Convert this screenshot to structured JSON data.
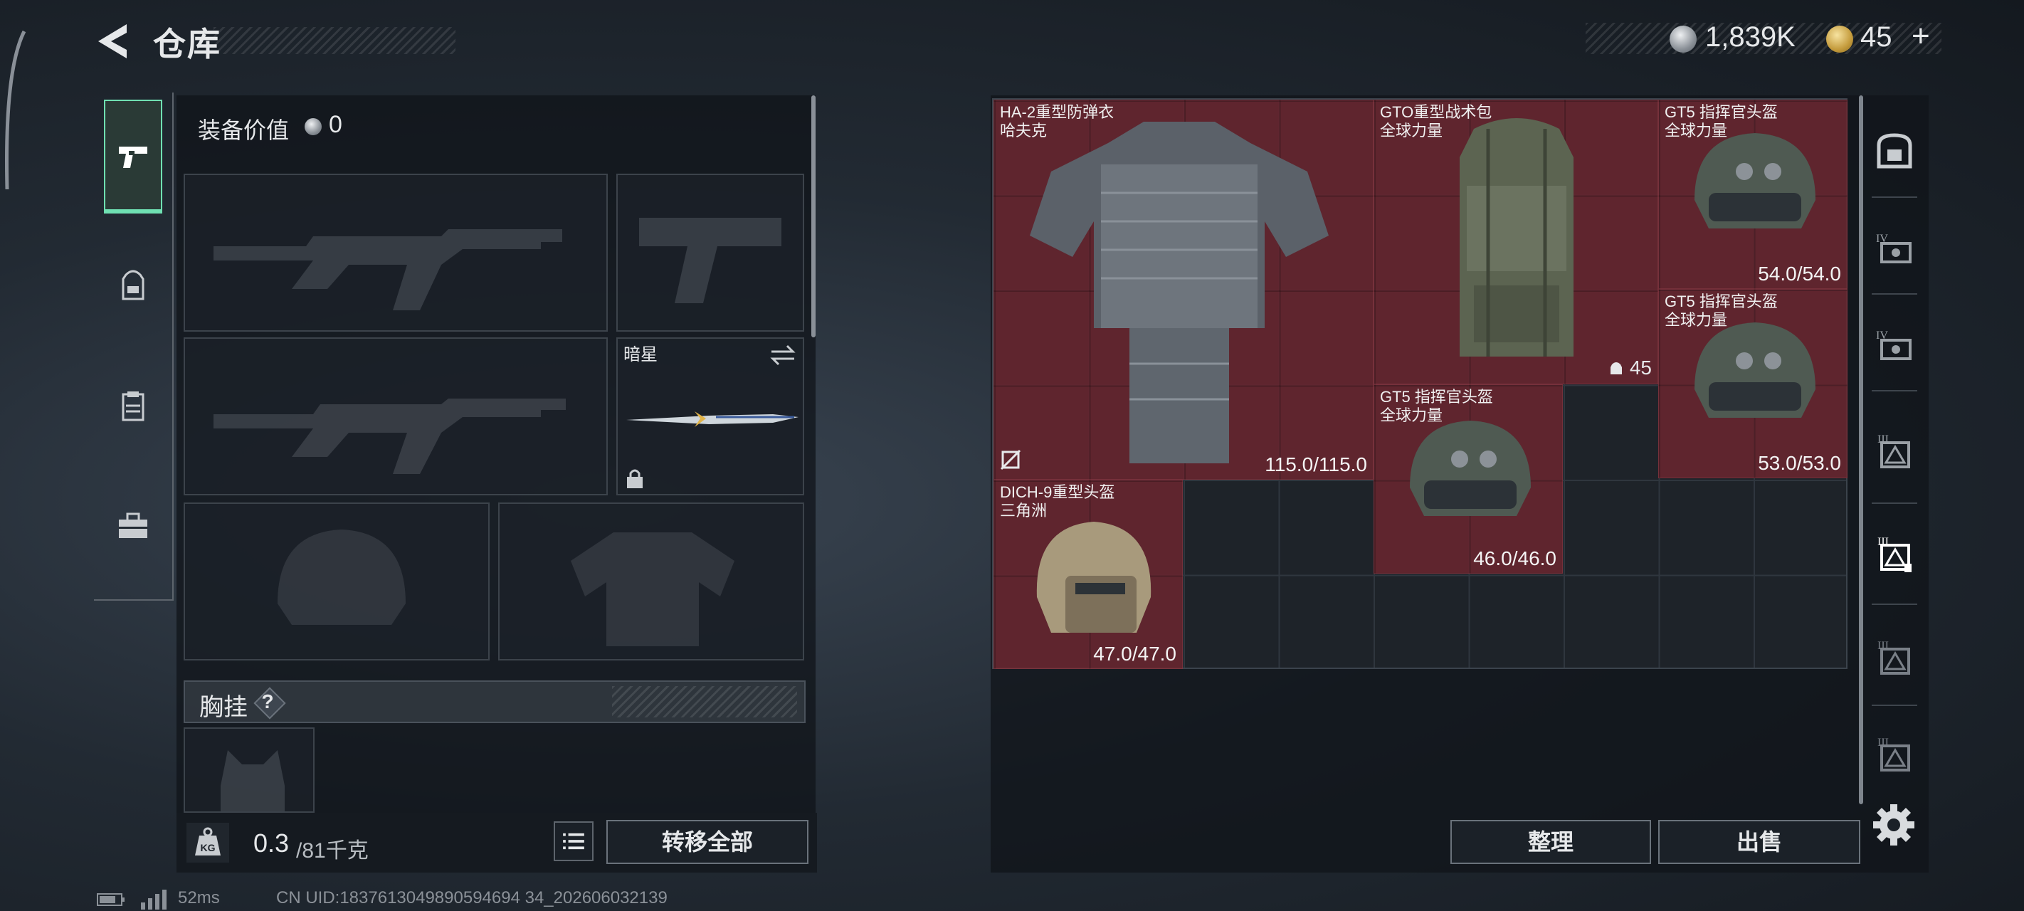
{
  "header": {
    "title": "仓库",
    "back_icon": "chevron-left-icon",
    "silver_amount": "1,839K",
    "gold_amount": "45",
    "gold_plus": "+"
  },
  "left_tabs": [
    {
      "name": "weapons",
      "icon": "pistol-icon",
      "active": true
    },
    {
      "name": "gear",
      "icon": "backpack-icon",
      "active": false
    },
    {
      "name": "consumables",
      "icon": "clipboard-icon",
      "active": false
    },
    {
      "name": "tools",
      "icon": "toolbox-icon",
      "active": false
    }
  ],
  "equipment": {
    "value_label": "装备价值",
    "value_amount": "0",
    "melee_name": "暗星",
    "chest_label": "胸挂",
    "chest_help": "?",
    "weight_current": "0.3",
    "weight_max": "/81千克",
    "transfer_all": "转移全部"
  },
  "storage": {
    "items": [
      {
        "id": "armor",
        "name": "HA-2重型防弹衣",
        "sub": "哈夫克",
        "durability": "115.0/115.0"
      },
      {
        "id": "backpack",
        "name": "GTO重型战术包",
        "sub": "全球力量",
        "capacity": "45"
      },
      {
        "id": "helmet-gt5-1",
        "name": "GT5 指挥官头盔",
        "sub": "全球力量",
        "durability": "54.0/54.0"
      },
      {
        "id": "helmet-gt5-2",
        "name": "GT5 指挥官头盔",
        "sub": "全球力量",
        "durability": "53.0/53.0"
      },
      {
        "id": "helmet-gt5-3",
        "name": "GT5 指挥官头盔",
        "sub": "全球力量",
        "durability": "46.0/46.0"
      },
      {
        "id": "helmet-dich",
        "name": "DICH-9重型头盔",
        "sub": "三角洲",
        "durability": "47.0/47.0"
      }
    ],
    "organize": "整理",
    "sell": "出售"
  },
  "right_tabs": [
    {
      "icon": "safe-box-icon"
    },
    {
      "icon": "storage-tier-iv-icon",
      "tier": "IV"
    },
    {
      "icon": "storage-tier-iv-icon",
      "tier": "IV"
    },
    {
      "icon": "storage-tier-iii-icon",
      "tier": "III"
    },
    {
      "icon": "storage-tier-iii-icon",
      "tier": "III",
      "active": true
    },
    {
      "icon": "storage-tier-iii-icon",
      "tier": "III"
    },
    {
      "icon": "storage-tier-iii-icon",
      "tier": "III"
    }
  ],
  "footer": {
    "ping": "52ms",
    "uid": "CN UID:1837613049890594694 34_202606032139"
  },
  "colors": {
    "accent_active": "#6fe0b2",
    "item_bg": "#6e2630",
    "panel_bg": "#101419"
  }
}
